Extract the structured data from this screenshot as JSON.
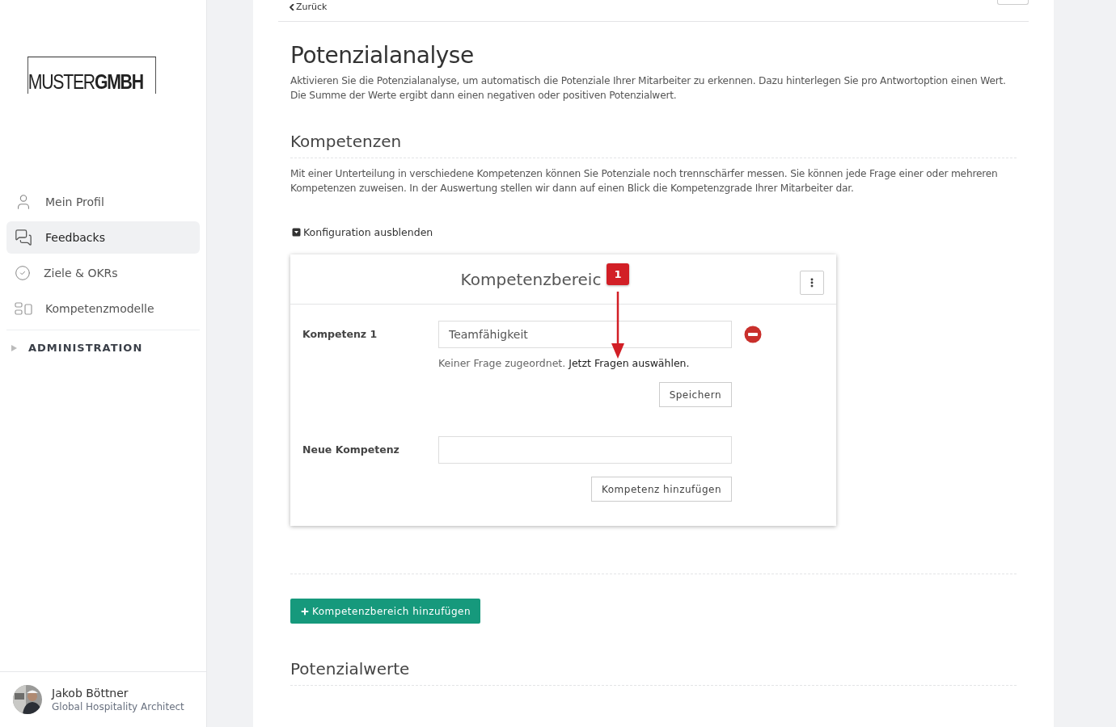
{
  "logo": {
    "light": "MUSTER",
    "bold": "GMBH"
  },
  "nav": [
    {
      "label": "Mein Profil",
      "selected": false
    },
    {
      "label": "Feedbacks",
      "selected": true
    },
    {
      "label": "Ziele & OKRs",
      "selected": false
    },
    {
      "label": "Kompetenzmodelle",
      "selected": false
    }
  ],
  "admin": {
    "label": "ADMINISTRATION",
    "expanded": false
  },
  "user": {
    "name": "Jakob Böttner",
    "role": "Global Hospitality Architect"
  },
  "back_link": "Zurück",
  "title": "Potenzialanalyse",
  "intro": "Aktivieren Sie die Potenzialanalyse, um automatisch die Potenziale Ihrer Mitarbeiter zu erkennen. Dazu hinterlegen Sie pro Antwortoption einen Wert. Die Summe der Werte ergibt dann einen negativen oder positiven Potenzialwert.",
  "section": {
    "title": "Kompetenzen",
    "text": "Mit einer Unterteilung in verschiedene Kompetenzen können Sie Potenziale noch trennschärfer messen. Sie können jede Frage einer oder mehreren Kompetenzen zuweisen. In der Auswertung stellen wir dann auf einen Blick die Kompetenzgrade Ihrer Mitarbeiter dar."
  },
  "config_toggle": {
    "label": "Konfiguration ausblenden",
    "expanded": true
  },
  "card": {
    "title": "Kompetenzbereic",
    "competences": [
      {
        "label": "Kompetenz 1",
        "value": "Teamfähigkeit",
        "hint": "Keiner Frage zugeordnet.",
        "link": "Jetzt Fragen auswählen.",
        "save": "Speichern"
      }
    ],
    "new": {
      "label": "Neue Kompetenz",
      "button": "Kompetenz hinzufügen"
    }
  },
  "annotation": {
    "label": "1"
  },
  "add_area_button": "Kompetenzbereich hinzufügen",
  "next_section": "Potenzialwerte"
}
